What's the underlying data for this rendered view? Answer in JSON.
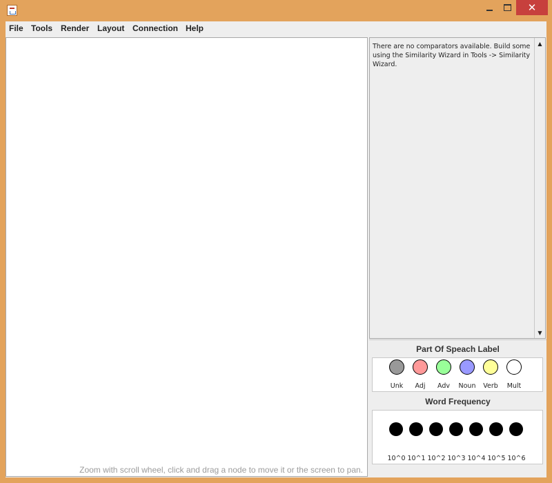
{
  "menu": {
    "items": [
      "File",
      "Tools",
      "Render",
      "Layout",
      "Connection",
      "Help"
    ]
  },
  "graph": {
    "hint": "Zoom with scroll wheel, click and drag a node to move it or the screen to pan."
  },
  "comparators": {
    "message": "There are no comparators available. Build some using the Similarity Wizard in Tools -> Similarity Wizard."
  },
  "part_of_speech": {
    "title": "Part Of Speach Label",
    "items": [
      {
        "label": "Unk",
        "color": "#999999"
      },
      {
        "label": "Adj",
        "color": "#ff9999"
      },
      {
        "label": "Adv",
        "color": "#99ff99"
      },
      {
        "label": "Noun",
        "color": "#9999ff"
      },
      {
        "label": "Verb",
        "color": "#ffff99"
      },
      {
        "label": "Mult",
        "color": "#ffffff"
      }
    ]
  },
  "word_frequency": {
    "title": "Word Frequency",
    "items": [
      "10^0",
      "10^1",
      "10^2",
      "10^3",
      "10^4",
      "10^5",
      "10^6"
    ]
  },
  "colors": {
    "window_frame": "#e3a35c",
    "close_button": "#c7403d",
    "panel_background": "#eeeeee"
  },
  "icons": {
    "app": "java-app-icon",
    "minimize": "minimize-icon",
    "maximize": "maximize-icon",
    "close": "close-icon",
    "scroll_up": "arrow-up-icon",
    "scroll_down": "arrow-down-icon"
  }
}
